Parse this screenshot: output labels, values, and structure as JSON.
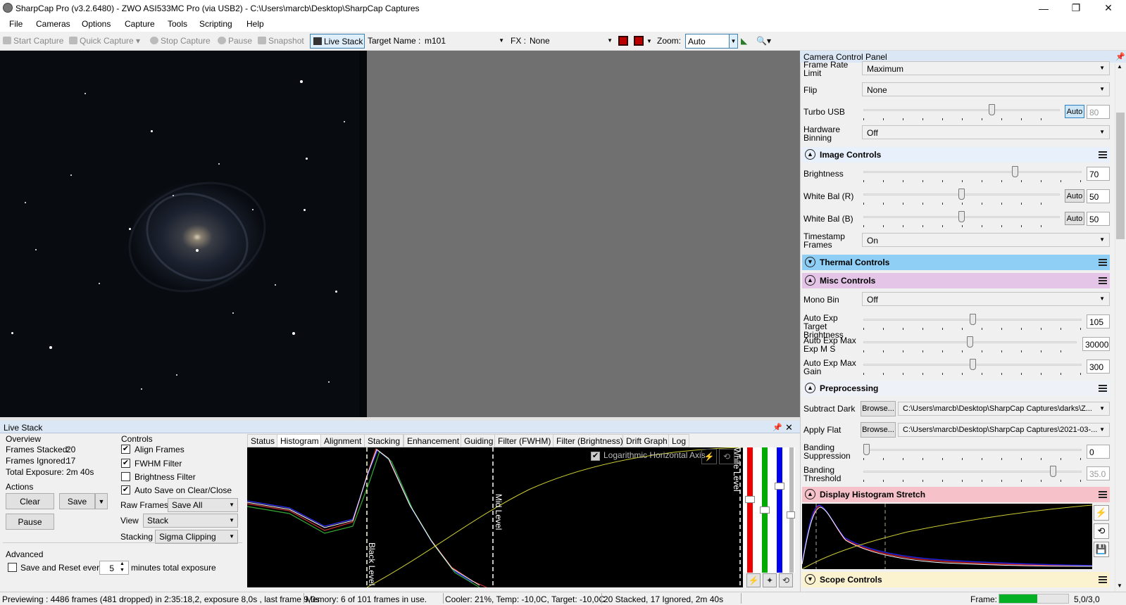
{
  "window": {
    "title": "SharpCap Pro (v3.2.6480) - ZWO ASI533MC Pro (via USB2) - C:\\Users\\marcb\\Desktop\\SharpCap Captures",
    "minimize": "—",
    "maximize": "❐",
    "close": "✕"
  },
  "menu": [
    "File",
    "Cameras",
    "Options",
    "Capture",
    "Tools",
    "Scripting",
    "Help"
  ],
  "toolbar": {
    "start_capture": "Start Capture",
    "quick_capture": "Quick Capture",
    "stop_capture": "Stop Capture",
    "pause": "Pause",
    "snapshot": "Snapshot",
    "live_stack": "Live Stack",
    "target_name_label": "Target Name :",
    "target_name_value": "m101",
    "fx_label": "FX :",
    "fx_value": "None",
    "zoom_label": "Zoom:",
    "zoom_value": "Auto"
  },
  "live_stack": {
    "title": "Live Stack",
    "overview": {
      "heading": "Overview",
      "frames_stacked_label": "Frames Stacked:",
      "frames_stacked": "20",
      "frames_ignored_label": "Frames Ignored:",
      "frames_ignored": "17",
      "total_exposure_label": "Total Exposure:",
      "total_exposure": "2m 40s"
    },
    "actions": {
      "heading": "Actions",
      "clear": "Clear",
      "save": "Save",
      "pause": "Pause"
    },
    "controls": {
      "heading": "Controls",
      "align_frames": "Align Frames",
      "fwhm_filter": "FWHM Filter",
      "brightness_filter": "Brightness Filter",
      "auto_save": "Auto Save on Clear/Close",
      "raw_frames_label": "Raw Frames",
      "raw_frames_value": "Save All",
      "view_label": "View",
      "view_value": "Stack",
      "stacking_label": "Stacking",
      "stacking_value": "Sigma Clipping"
    },
    "align_frames_checked": true,
    "fwhm_filter_checked": true,
    "brightness_filter_checked": false,
    "auto_save_checked": true,
    "advanced": {
      "heading": "Advanced",
      "save_reset_label": "Save and Reset every",
      "save_reset_value": "5",
      "save_reset_suffix": "minutes total exposure",
      "save_reset_checked": false
    },
    "tabs": [
      "Status",
      "Histogram",
      "Alignment",
      "Stacking",
      "Enhancement",
      "Guiding",
      "Filter (FWHM)",
      "Filter (Brightness)",
      "Drift Graph",
      "Log"
    ],
    "selected_tab": "Histogram",
    "histogram": {
      "log_axis_label": "Logarithmic Horizontal Axis",
      "log_axis_checked": true,
      "black_level": "Black Level",
      "mid_level": "Mid Level",
      "white_level": "White Level"
    }
  },
  "ccp": {
    "title": "Camera Control Panel",
    "frame_rate_limit": {
      "label": "Frame Rate Limit",
      "value": "Maximum"
    },
    "flip": {
      "label": "Flip",
      "value": "None"
    },
    "turbo_usb": {
      "label": "Turbo USB",
      "auto": "Auto",
      "value": "80",
      "level": 0.66
    },
    "hardware_binning": {
      "label": "Hardware Binning",
      "value": "Off"
    },
    "image_controls": {
      "title": "Image Controls",
      "brightness": {
        "label": "Brightness",
        "value": "70",
        "level": 0.7
      },
      "wb_r": {
        "label": "White Bal (R)",
        "auto": "Auto",
        "value": "50",
        "level": 0.5
      },
      "wb_b": {
        "label": "White Bal (B)",
        "auto": "Auto",
        "value": "50",
        "level": 0.5
      },
      "timestamp": {
        "label": "Timestamp Frames",
        "value": "On"
      }
    },
    "thermal_controls": {
      "title": "Thermal Controls"
    },
    "misc_controls": {
      "title": "Misc Controls",
      "mono_bin": {
        "label": "Mono Bin",
        "value": "Off"
      },
      "auto_exp_target": {
        "label": "Auto Exp Target Brightness",
        "value": "105",
        "level": 0.5
      },
      "auto_exp_max_exp": {
        "label": "Auto Exp Max Exp M S",
        "value": "30000",
        "level": 0.5
      },
      "auto_exp_max_gain": {
        "label": "Auto Exp Max Gain",
        "value": "300",
        "level": 0.5
      }
    },
    "preprocessing": {
      "title": "Preprocessing",
      "subtract_dark": {
        "label": "Subtract Dark",
        "browse": "Browse...",
        "value": "C:\\Users\\marcb\\Desktop\\SharpCap Captures\\darks\\Z..."
      },
      "apply_flat": {
        "label": "Apply Flat",
        "browse": "Browse...",
        "value": "C:\\Users\\marcb\\Desktop\\SharpCap Captures\\2021-03-..."
      },
      "banding_suppression": {
        "label": "Banding Suppression",
        "value": "0",
        "level": 0.0
      },
      "banding_threshold": {
        "label": "Banding Threshold",
        "value": "35.0",
        "level": 0.88
      }
    },
    "display_histogram_stretch": {
      "title": "Display Histogram Stretch"
    },
    "scope_controls": {
      "title": "Scope Controls"
    },
    "colors": {
      "image_controls": "#e8f1fb",
      "thermal": "#8fcff5",
      "misc": "#e4c5e8",
      "preprocessing": "#eef1f7",
      "histogram_stretch": "#f6c1c9",
      "scope": "#fbf2cf"
    }
  },
  "status": {
    "previewing": "Previewing : 4486 frames (481 dropped) in 2:35:18,2, exposure 8,0s , last frame 9,0s",
    "memory": "Memory: 6 of 101 frames in use.",
    "cooler": "Cooler: 21%, Temp: -10,0C, Target: -10,0C",
    "stacked": "20 Stacked, 17 Ignored, 2m 40s",
    "frame_label": "Frame:",
    "frame_value": "5,0/3,0",
    "frame_progress": 0.55
  }
}
